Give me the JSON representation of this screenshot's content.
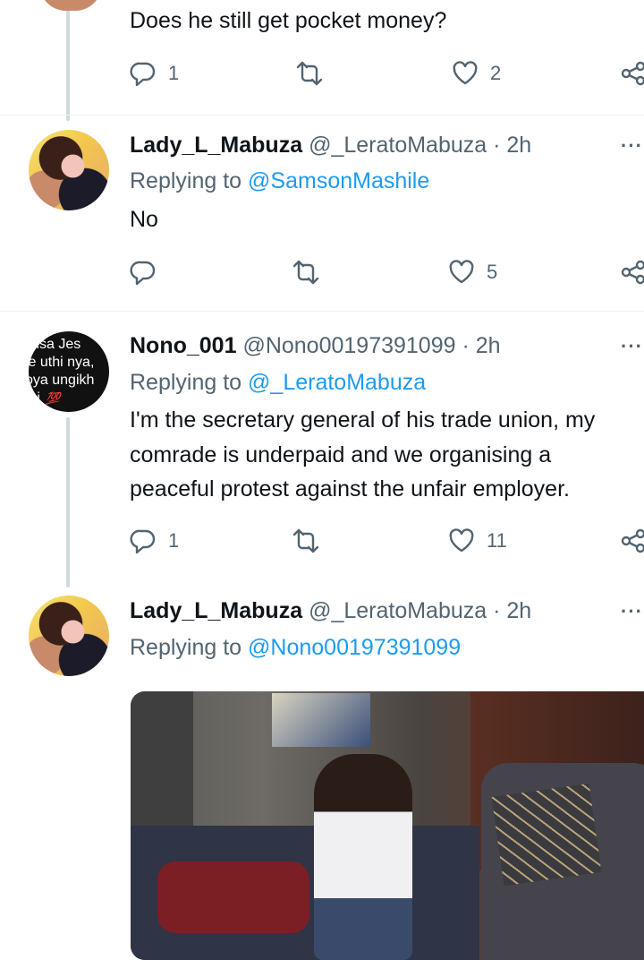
{
  "tweet0": {
    "text": "Does he still get pocket money?",
    "replies": "1",
    "likes": "2"
  },
  "tweet1": {
    "name": "Lady_L_Mabuza",
    "handle": "@_LeratoMabuza",
    "sep": "·",
    "time": "2h",
    "replying_prefix": "Replying to",
    "replying_to": "@SamsonMashile",
    "text": "No",
    "likes": "5"
  },
  "tweet2": {
    "name": "Nono_001",
    "handle": "@Nono00197391099",
    "sep": "·",
    "time": "2h",
    "avatar_lines": [
      "ulisa Jes",
      "le uthi nya,",
      "oya ungikh",
      "mi"
    ],
    "avatar_emoji": "💯",
    "replying_prefix": "Replying to",
    "replying_to": "@_LeratoMabuza",
    "text_lines": [
      "I'm the secretary general of his trade union, my",
      "comrade is underpaid and we organising a",
      "peaceful protest against the unfair employer."
    ],
    "replies": "1",
    "likes": "11"
  },
  "tweet3": {
    "name": "Lady_L_Mabuza",
    "handle": "@_LeratoMabuza",
    "sep": "·",
    "time": "2h",
    "replying_prefix": "Replying to",
    "replying_to": "@Nono00197391099"
  },
  "icons": {
    "reply": "reply-icon",
    "retweet": "retweet-icon",
    "like": "like-icon",
    "share": "share-icon",
    "more": "more-icon"
  },
  "more_glyph": "···",
  "colors": {
    "link": "#1d9bf0",
    "secondary": "#536471",
    "thread_line": "#cfd9de"
  }
}
